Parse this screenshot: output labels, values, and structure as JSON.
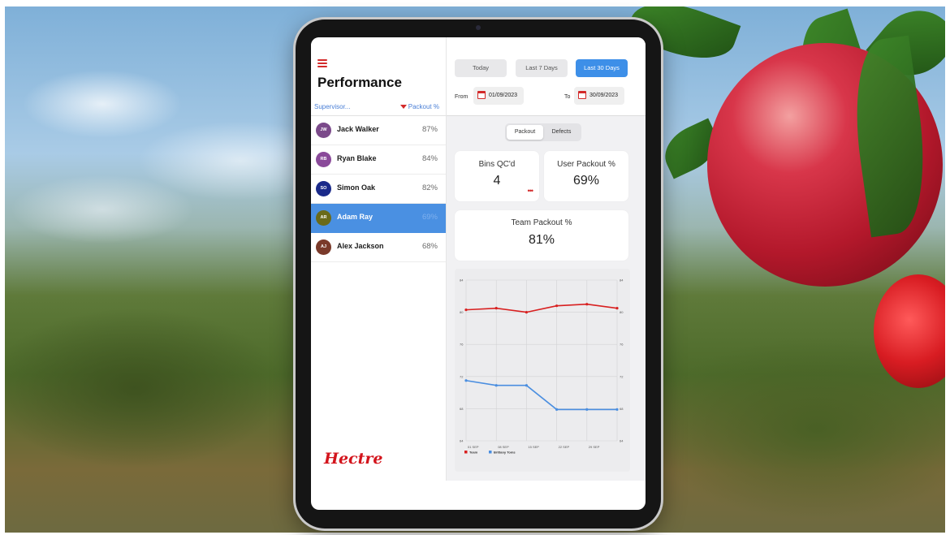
{
  "colors": {
    "accent": "#3d8fe8",
    "brand": "#d3141c",
    "team_series": "#d82020",
    "person_series": "#4a8ee0"
  },
  "header": {
    "title": "Performance"
  },
  "table": {
    "columns": {
      "supervisor": "Supervisor...",
      "packout": "Packout %"
    },
    "rows": [
      {
        "initials": "JW",
        "name": "Jack Walker",
        "packout": "87%",
        "avatar_color": "#7b4a8a"
      },
      {
        "initials": "RB",
        "name": "Ryan Blake",
        "packout": "84%",
        "avatar_color": "#8a4a9a"
      },
      {
        "initials": "SO",
        "name": "Simon Oak",
        "packout": "82%",
        "avatar_color": "#1a2a8a"
      },
      {
        "initials": "AR",
        "name": "Adam Ray",
        "packout": "69%",
        "avatar_color": "#6a6a1a"
      },
      {
        "initials": "AJ",
        "name": "Alex Jackson",
        "packout": "68%",
        "avatar_color": "#7a3a2a"
      }
    ],
    "selected_index": 3
  },
  "brand": {
    "logo_text": "Hectre"
  },
  "filters": {
    "ranges": [
      "Today",
      "Last 7 Days",
      "Last 30 Days"
    ],
    "active_range": "Last 30 Days",
    "from_label": "From",
    "from_date": "01/09/2023",
    "to_label": "To",
    "to_date": "30/09/2023"
  },
  "tabs": {
    "packout": "Packout",
    "defects": "Defects",
    "active": "Packout"
  },
  "stats": {
    "bins_label": "Bins QC'd",
    "bins_value": "4",
    "bins_more": "•••",
    "user_label": "User Packout %",
    "user_value": "69%",
    "team_label": "Team Packout %",
    "team_value": "81%"
  },
  "chart_data": {
    "type": "line",
    "x": [
      "01 SEP",
      "08 SEP",
      "15 SEP",
      "22 SEP",
      "29 SEP"
    ],
    "series": [
      {
        "name": "Team",
        "values": [
          80.3,
          80.5,
          80.0,
          80.8,
          81.0,
          80.5
        ]
      },
      {
        "name": "Brittany Toms",
        "values": [
          71.5,
          70.9,
          70.9,
          67.9,
          67.9,
          67.9
        ]
      }
    ],
    "y_ticks": [
      "64",
      "68",
      "72",
      "76",
      "80",
      "84"
    ],
    "ylim": [
      64,
      84
    ],
    "grid": true,
    "legend_position": "bottom-left"
  }
}
